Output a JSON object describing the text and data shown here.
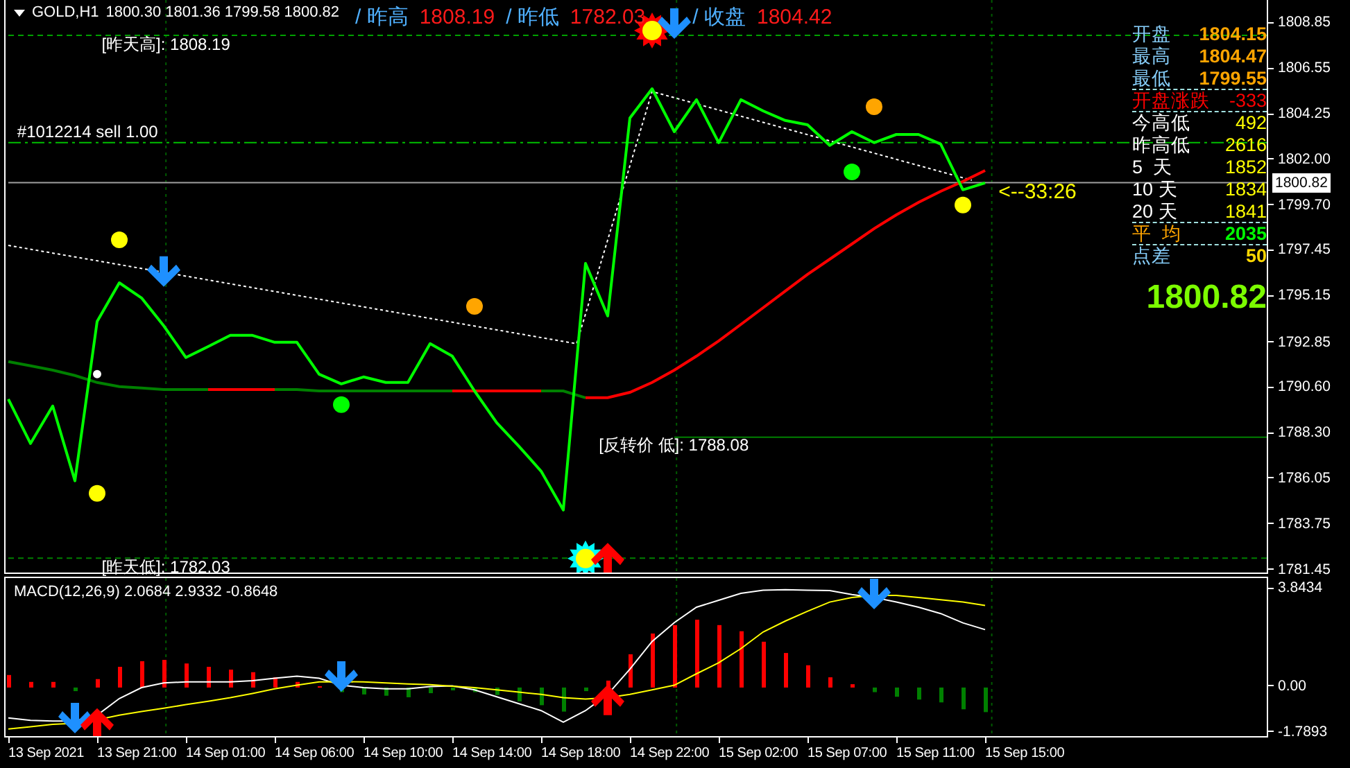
{
  "header": {
    "symbol": "GOLD,H1",
    "ohlc": "1800.30 1801.36 1799.58 1800.82"
  },
  "daily_levels": [
    {
      "label": "/ 昨高",
      "value": "1808.19"
    },
    {
      "label": "/ 昨低",
      "value": "1782.03"
    },
    {
      "label": "/ 收盘",
      "value": "1804.42"
    }
  ],
  "main_chart": {
    "current_price": "1800.82",
    "labels": [
      {
        "text": "[昨天高]: 1808.19",
        "color": "#ffffff"
      },
      {
        "text": "#1012214 sell 1.00",
        "color": "#ffffff"
      },
      {
        "text": "[反转价 低]: 1788.08",
        "color": "#ffffff"
      },
      {
        "text": "[昨天低]: 1782.03",
        "color": "#ffffff"
      },
      {
        "text": "<--33:26",
        "color": "#ffff00"
      }
    ],
    "price_axis": [
      "1808.85",
      "1806.55",
      "1804.25",
      "1802.00",
      "1799.70",
      "1797.45",
      "1795.15",
      "1792.85",
      "1790.60",
      "1788.30",
      "1786.05",
      "1783.75",
      "1781.45"
    ]
  },
  "stats": {
    "rows": [
      {
        "kind": "price",
        "label": "开盘",
        "value": "1804.15",
        "rule_below": false
      },
      {
        "kind": "price",
        "label": "最高",
        "value": "1804.47",
        "rule_below": false
      },
      {
        "kind": "price",
        "label": "最低",
        "value": "1799.55",
        "rule_below": true
      },
      {
        "kind": "change",
        "label": "开盘涨跌",
        "value": "-333",
        "rule_below": true
      },
      {
        "kind": "range",
        "label": "今高低",
        "value": "492",
        "rule_below": false
      },
      {
        "kind": "range",
        "label": "昨高低",
        "value": "2616",
        "rule_below": false
      },
      {
        "kind": "range",
        "label": "5  天",
        "value": "1852",
        "rule_below": false
      },
      {
        "kind": "range",
        "label": "10 天",
        "value": "1834",
        "rule_below": false
      },
      {
        "kind": "range",
        "label": "20 天",
        "value": "1841",
        "rule_below": true
      },
      {
        "kind": "average",
        "label": "平  均",
        "value": "2035",
        "rule_below": true
      },
      {
        "kind": "spread",
        "label": "点差",
        "value": "50",
        "rule_below": false
      }
    ],
    "price": "1800.82"
  },
  "macd": {
    "title": "MACD(12,26,9) 2.0684 2.9332 -0.8648",
    "value_axis": [
      "3.8434",
      "0.00",
      "-1.7893"
    ]
  },
  "time_axis": [
    "13 Sep 2021",
    "13 Sep 21:00",
    "14 Sep 01:00",
    "14 Sep 06:00",
    "14 Sep 10:00",
    "14 Sep 14:00",
    "14 Sep 18:00",
    "14 Sep 22:00",
    "15 Sep 02:00",
    "15 Sep 07:00",
    "15 Sep 11:00",
    "15 Sep 15:00"
  ]
}
